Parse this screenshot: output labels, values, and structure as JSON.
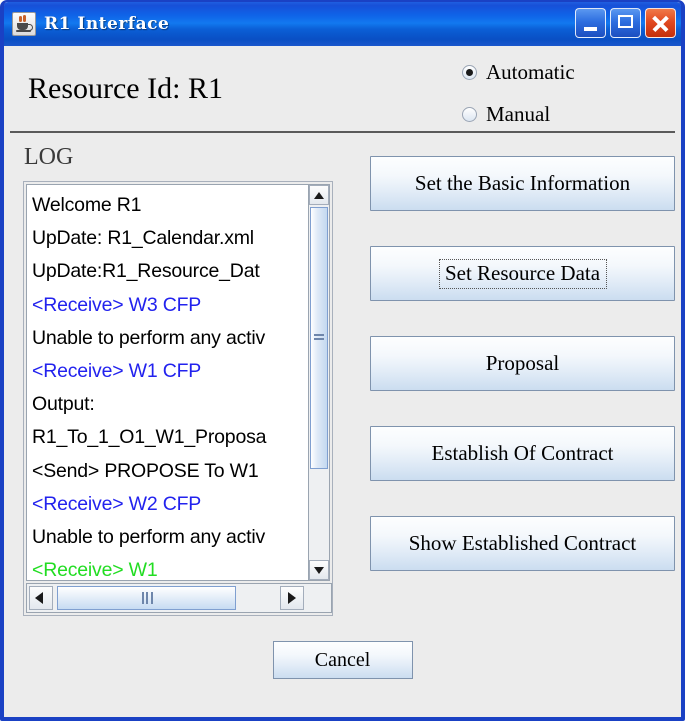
{
  "window": {
    "title": "R1 Interface",
    "icon": "java-cup-icon",
    "controls": {
      "minimize": "minimize-button",
      "maximize": "maximize-button",
      "close": "close-button"
    }
  },
  "header": {
    "resource_id_text": "Resource Id:  R1",
    "mode_options": [
      {
        "label": "Automatic",
        "selected": true
      },
      {
        "label": "Manual",
        "selected": false
      }
    ]
  },
  "log": {
    "label": "LOG",
    "entries": [
      {
        "text": "Welcome R1",
        "color": "black"
      },
      {
        "text": "UpDate: R1_Calendar.xml",
        "color": "black"
      },
      {
        "text": "UpDate:R1_Resource_Dat",
        "color": "black"
      },
      {
        "text": "<Receive> W3 CFP",
        "color": "blue"
      },
      {
        "text": "Unable to perform any activ",
        "color": "black"
      },
      {
        "text": "<Receive> W1 CFP",
        "color": "blue"
      },
      {
        "text": "Output:",
        "color": "black"
      },
      {
        "text": "R1_To_1_O1_W1_Proposa",
        "color": "black"
      },
      {
        "text": "<Send> PROPOSE To W1",
        "color": "black"
      },
      {
        "text": "<Receive> W2 CFP",
        "color": "blue"
      },
      {
        "text": "Unable to perform any activ",
        "color": "black"
      },
      {
        "text": "<Receive> W1",
        "color": "green"
      }
    ],
    "colors": {
      "black": "#000000",
      "blue": "#2222ee",
      "green": "#22dd22"
    }
  },
  "actions": {
    "buttons": [
      {
        "label": "Set the Basic Information",
        "focused": false
      },
      {
        "label": "Set Resource Data",
        "focused": true
      },
      {
        "label": "Proposal",
        "focused": false
      },
      {
        "label": "Establish Of Contract",
        "focused": false
      },
      {
        "label": "Show Established Contract",
        "focused": false
      }
    ]
  },
  "footer": {
    "cancel_label": "Cancel"
  }
}
